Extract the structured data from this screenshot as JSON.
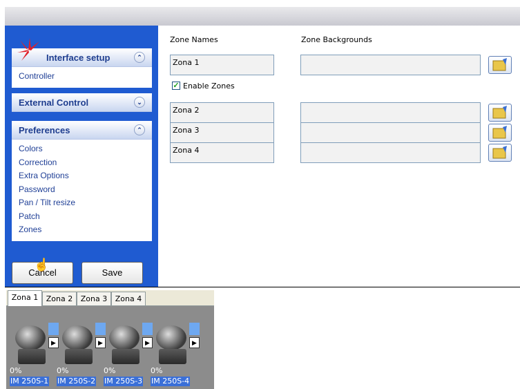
{
  "sidebar": {
    "panels": [
      {
        "title": "Interface setup",
        "collapse_icon": "chevron-up-double",
        "items": [
          "Controller"
        ]
      },
      {
        "title": "External Control",
        "collapse_icon": "chevron-down-double",
        "items": []
      },
      {
        "title": "Preferences",
        "collapse_icon": "chevron-up-double",
        "items": [
          "Colors",
          "Correction",
          "Extra Options",
          "Password",
          "Pan / Tilt resize",
          "Patch",
          "Zones"
        ]
      }
    ],
    "cancel_label": "Cancel",
    "save_label": "Save"
  },
  "content": {
    "zone_names_header": "Zone Names",
    "zone_backgrounds_header": "Zone Backgrounds",
    "enable_zones_label": "Enable Zones",
    "enable_zones_checked": true,
    "zones": [
      {
        "name": "Zona 1",
        "background": ""
      },
      {
        "name": "Zona 2",
        "background": ""
      },
      {
        "name": "Zona 3",
        "background": ""
      },
      {
        "name": "Zona 4",
        "background": ""
      }
    ]
  },
  "preview": {
    "tabs": [
      "Zona 1",
      "Zona 2",
      "Zona 3",
      "Zona 4"
    ],
    "active_tab": "Zona 1",
    "fixtures": [
      {
        "percent": "0%",
        "label": "IM 250S-1"
      },
      {
        "percent": "0%",
        "label": "IM 250S-2"
      },
      {
        "percent": "0%",
        "label": "IM 250S-3"
      },
      {
        "percent": "0%",
        "label": "IM 250S-4"
      }
    ]
  },
  "colors": {
    "sidebar_blue": "#1f5bd1",
    "link_blue": "#1f3f96",
    "selection_blue": "#3a6fd8"
  }
}
